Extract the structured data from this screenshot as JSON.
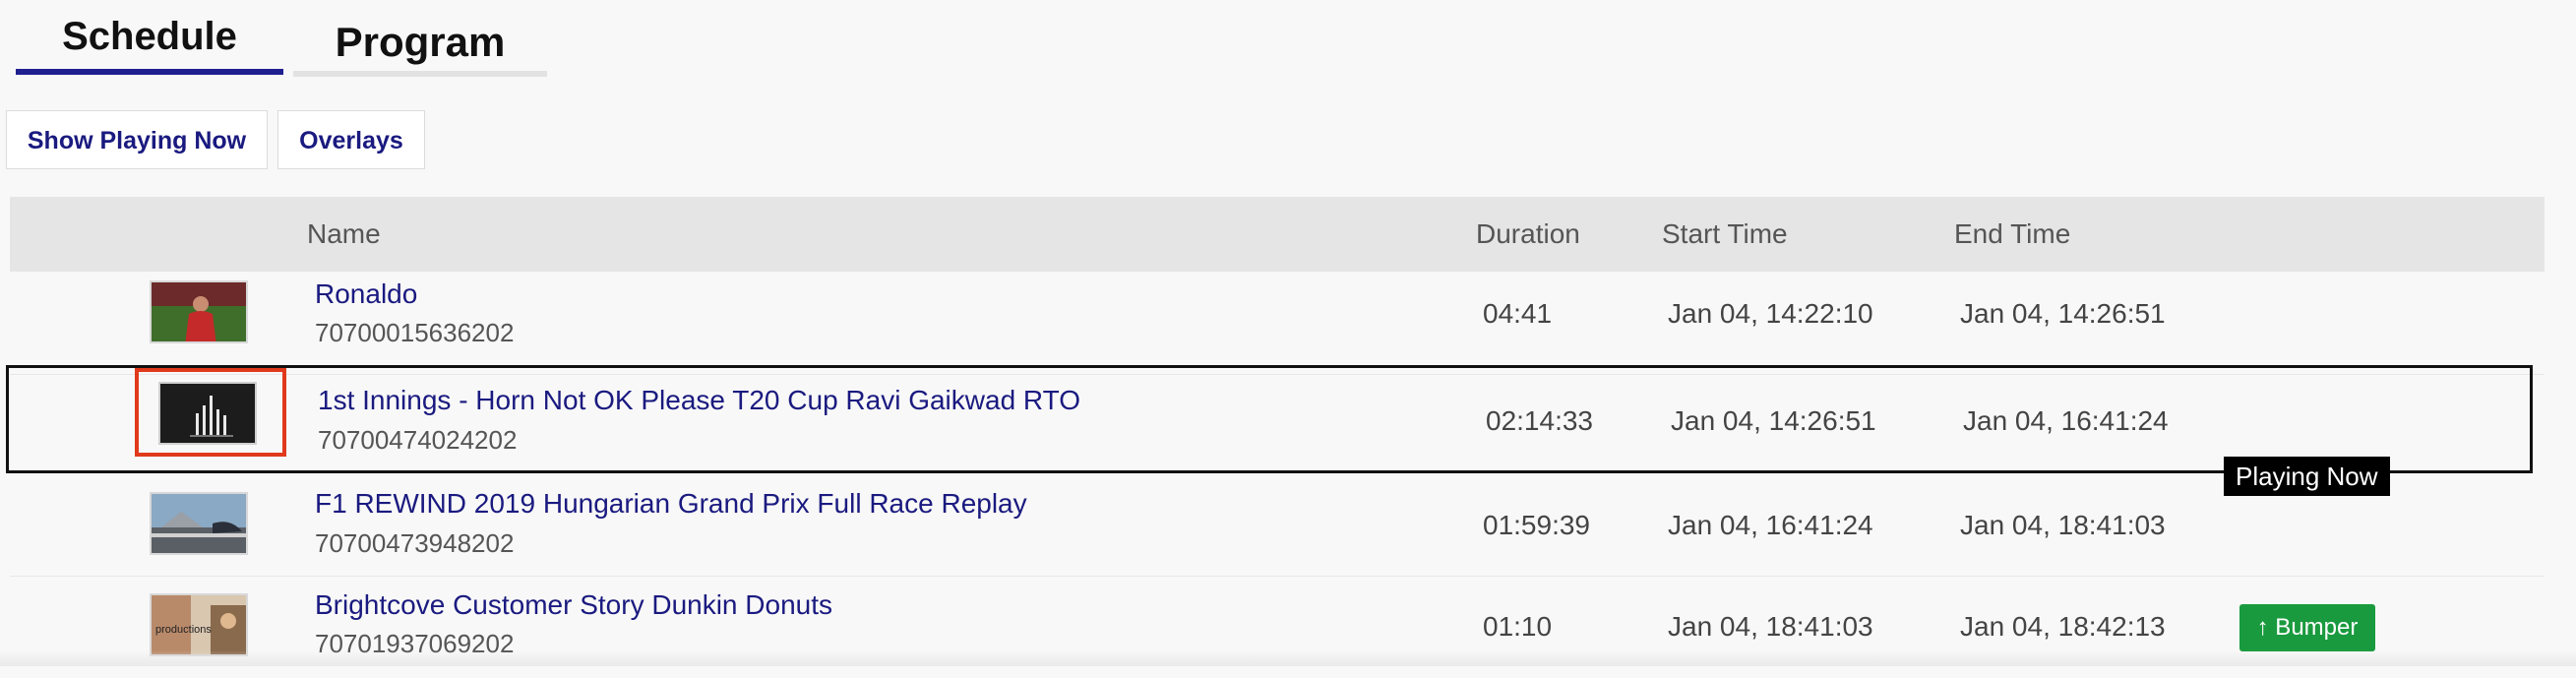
{
  "tabs": {
    "schedule": "Schedule",
    "program": "Program"
  },
  "actions": {
    "show_playing_now": "Show Playing Now",
    "overlays": "Overlays"
  },
  "table": {
    "headers": {
      "name": "Name",
      "duration": "Duration",
      "start": "Start Time",
      "end": "End Time"
    },
    "rows": [
      {
        "title": "Ronaldo",
        "id": "70700015636202",
        "duration": "04:41",
        "start": "Jan 04, 14:22:10",
        "end": "Jan 04, 14:26:51"
      },
      {
        "title": "1st Innings - Horn Not OK Please T20 Cup Ravi Gaikwad RTO",
        "id": "70700474024202",
        "duration": "02:14:33",
        "start": "Jan 04, 14:26:51",
        "end": "Jan 04, 16:41:24"
      },
      {
        "title": "F1 REWIND 2019 Hungarian Grand Prix Full Race Replay",
        "id": "70700473948202",
        "duration": "01:59:39",
        "start": "Jan 04, 16:41:24",
        "end": "Jan 04, 18:41:03"
      },
      {
        "title": "Brightcove Customer Story Dunkin Donuts",
        "id": "70701937069202",
        "duration": "01:10",
        "start": "Jan 04, 18:41:03",
        "end": "Jan 04, 18:42:13"
      }
    ]
  },
  "badges": {
    "playing_now": "Playing Now",
    "bumper": "↑ Bumper"
  },
  "thumb_text": {
    "productions": "productions"
  },
  "colors": {
    "accent": "#1f1f8f",
    "link": "#1a1a80",
    "selection_border": "#e0391c",
    "bumper_green": "#1a9a3e"
  }
}
